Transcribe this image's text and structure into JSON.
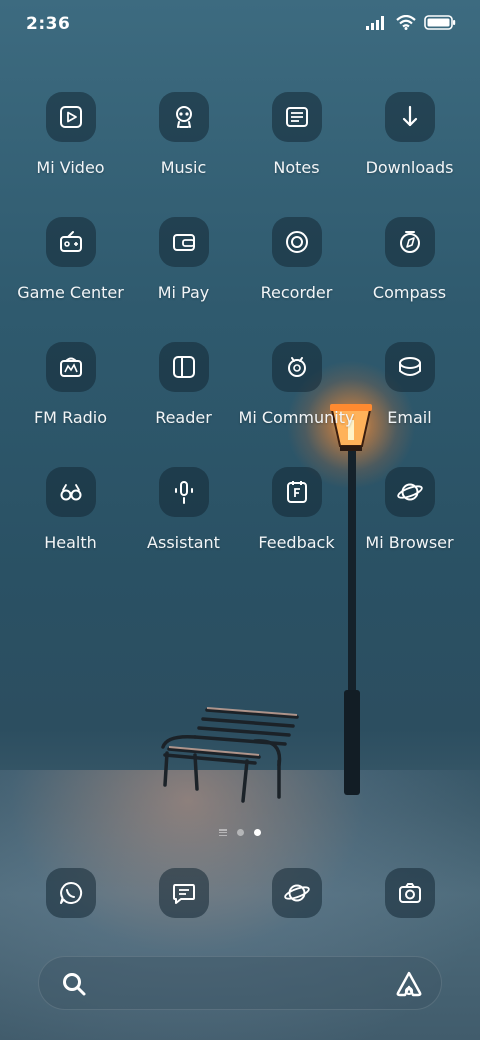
{
  "status_bar": {
    "time": "2:36"
  },
  "apps": [
    {
      "name": "mi-video",
      "label": "Mi Video",
      "icon": "video-play-icon"
    },
    {
      "name": "music",
      "label": "Music",
      "icon": "music-alien-icon"
    },
    {
      "name": "notes",
      "label": "Notes",
      "icon": "notes-icon"
    },
    {
      "name": "downloads",
      "label": "Downloads",
      "icon": "download-arrow-icon"
    },
    {
      "name": "game-center",
      "label": "Game Center",
      "icon": "gamepad-icon"
    },
    {
      "name": "mi-pay",
      "label": "Mi Pay",
      "icon": "wallet-icon"
    },
    {
      "name": "recorder",
      "label": "Recorder",
      "icon": "record-icon"
    },
    {
      "name": "compass",
      "label": "Compass",
      "icon": "compass-icon"
    },
    {
      "name": "fm-radio",
      "label": "FM Radio",
      "icon": "radio-icon"
    },
    {
      "name": "reader",
      "label": "Reader",
      "icon": "book-icon"
    },
    {
      "name": "mi-community",
      "label": "Mi Community",
      "icon": "community-icon"
    },
    {
      "name": "email",
      "label": "Email",
      "icon": "email-icon"
    },
    {
      "name": "health",
      "label": "Health",
      "icon": "health-glasses-icon"
    },
    {
      "name": "assistant",
      "label": "Assistant",
      "icon": "microphone-icon"
    },
    {
      "name": "feedback",
      "label": "Feedback",
      "icon": "feedback-icon"
    },
    {
      "name": "mi-browser",
      "label": "Mi Browser",
      "icon": "planet-icon"
    }
  ],
  "dock": [
    {
      "name": "whatsapp",
      "icon": "whatsapp-icon"
    },
    {
      "name": "messages",
      "icon": "message-icon"
    },
    {
      "name": "browser",
      "icon": "planet-icon"
    },
    {
      "name": "camera",
      "icon": "camera-icon"
    }
  ],
  "page_indicator": {
    "pages": 2,
    "current": 2
  },
  "search_bar": {
    "left_icon": "search-icon",
    "right_icon": "assistant-logo-icon"
  }
}
